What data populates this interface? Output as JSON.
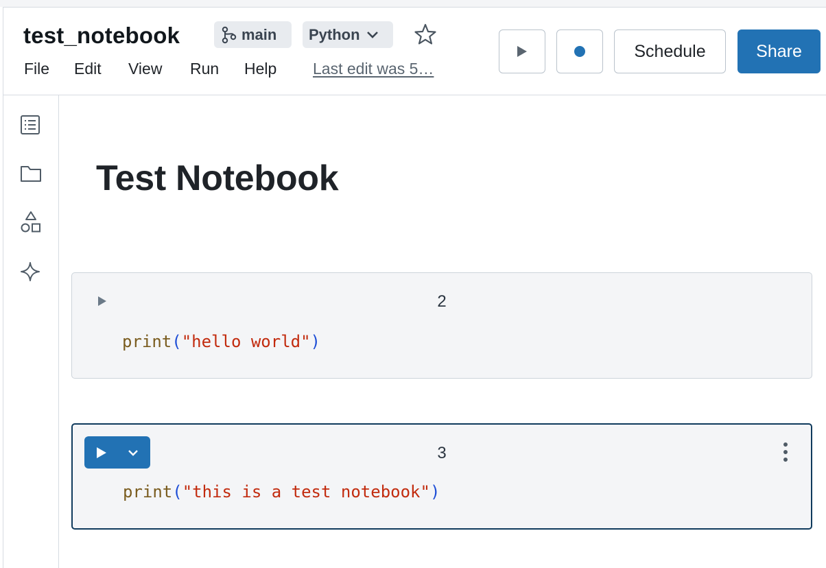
{
  "header": {
    "notebook_title": "test_notebook",
    "branch": "main",
    "language": "Python",
    "menu": [
      "File",
      "Edit",
      "View",
      "Run",
      "Help"
    ],
    "last_edit": "Last edit was 5…",
    "schedule_label": "Schedule",
    "share_label": "Share"
  },
  "sidebar": {
    "items": [
      "table-of-contents-icon",
      "folder-icon",
      "shapes-icon",
      "sparkle-icon"
    ]
  },
  "notebook": {
    "title": "Test Notebook",
    "cells": [
      {
        "number": "2",
        "code_fn": "print",
        "code_open": "(",
        "code_str": "\"hello world\"",
        "code_close": ")"
      },
      {
        "number": "3",
        "code_fn": "print",
        "code_open": "(",
        "code_str": "\"this is a test notebook\"",
        "code_close": ")"
      }
    ]
  },
  "colors": {
    "accent": "#2272b4",
    "selected_border": "#0f3a5c",
    "cell_background": "#f4f5f7",
    "string": "#c22b0e",
    "function": "#7a5c1f",
    "paren": "#1f4fd6"
  }
}
